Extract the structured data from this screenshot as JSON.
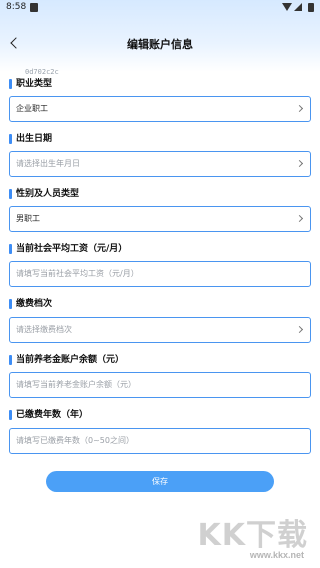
{
  "status_bar": {
    "time": "8:58"
  },
  "header": {
    "title": "编辑账户信息"
  },
  "debug_tag": "0d702c2c",
  "form": {
    "occupation": {
      "label": "职业类型",
      "value": "企业职工"
    },
    "birth_date": {
      "label": "出生日期",
      "placeholder": "请选择出生年月日"
    },
    "gender_type": {
      "label": "性别及人员类型",
      "value": "男职工"
    },
    "avg_wage": {
      "label": "当前社会平均工资（元/月）",
      "placeholder": "请填写当前社会平均工资（元/月）"
    },
    "pay_level": {
      "label": "缴费档次",
      "placeholder": "请选择缴费档次"
    },
    "pension_balance": {
      "label": "当前养老金账户余额（元）",
      "placeholder": "请填写当前养老金账户余额（元）"
    },
    "paid_years": {
      "label": "已缴费年数（年）",
      "placeholder": "请填写已缴费年数（0~50之间）"
    }
  },
  "actions": {
    "save_label": "保存"
  },
  "watermark": {
    "text": "KK下载",
    "url": "www.kkx.net"
  },
  "colors": {
    "accent": "#3d8df5",
    "button": "#4ba0f7",
    "field_border": "#4a95f0"
  }
}
